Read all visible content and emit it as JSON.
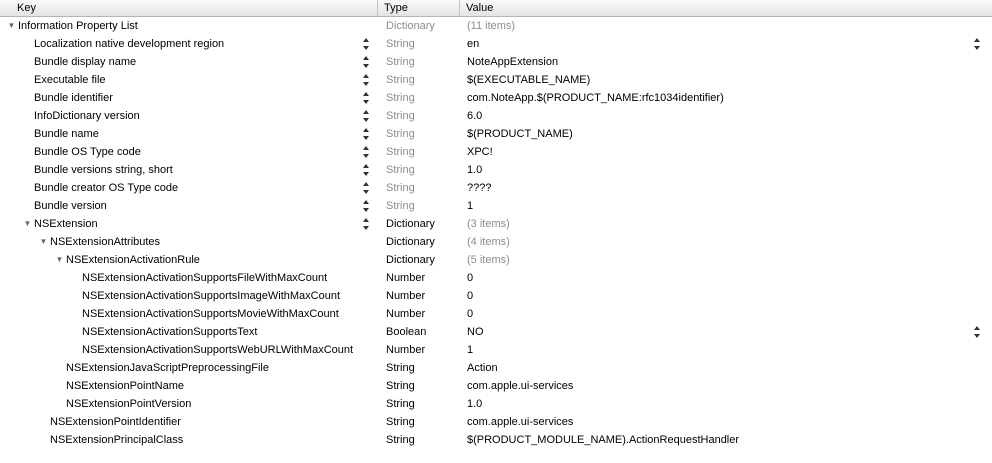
{
  "header": {
    "key": "Key",
    "type": "Type",
    "value": "Value"
  },
  "rows": [
    {
      "key": "Information Property List",
      "type": "Dictionary",
      "value": "(11 items)",
      "level": 0,
      "expand": true,
      "dim": true,
      "keyStepper": false,
      "valueStepper": false
    },
    {
      "key": "Localization native development region",
      "type": "String",
      "value": "en",
      "level": 1,
      "expand": false,
      "dim": false,
      "keyStepper": true,
      "valueStepper": true
    },
    {
      "key": "Bundle display name",
      "type": "String",
      "value": "NoteAppExtension",
      "level": 1,
      "expand": false,
      "dim": false,
      "keyStepper": true,
      "valueStepper": false
    },
    {
      "key": "Executable file",
      "type": "String",
      "value": "$(EXECUTABLE_NAME)",
      "level": 1,
      "expand": false,
      "dim": false,
      "keyStepper": true,
      "valueStepper": false
    },
    {
      "key": "Bundle identifier",
      "type": "String",
      "value": "com.NoteApp.$(PRODUCT_NAME:rfc1034identifier)",
      "level": 1,
      "expand": false,
      "dim": false,
      "keyStepper": true,
      "valueStepper": false
    },
    {
      "key": "InfoDictionary version",
      "type": "String",
      "value": "6.0",
      "level": 1,
      "expand": false,
      "dim": false,
      "keyStepper": true,
      "valueStepper": false
    },
    {
      "key": "Bundle name",
      "type": "String",
      "value": "$(PRODUCT_NAME)",
      "level": 1,
      "expand": false,
      "dim": false,
      "keyStepper": true,
      "valueStepper": false
    },
    {
      "key": "Bundle OS Type code",
      "type": "String",
      "value": "XPC!",
      "level": 1,
      "expand": false,
      "dim": false,
      "keyStepper": true,
      "valueStepper": false
    },
    {
      "key": "Bundle versions string, short",
      "type": "String",
      "value": "1.0",
      "level": 1,
      "expand": false,
      "dim": false,
      "keyStepper": true,
      "valueStepper": false
    },
    {
      "key": "Bundle creator OS Type code",
      "type": "String",
      "value": "????",
      "level": 1,
      "expand": false,
      "dim": false,
      "keyStepper": true,
      "valueStepper": false
    },
    {
      "key": "Bundle version",
      "type": "String",
      "value": "1",
      "level": 1,
      "expand": false,
      "dim": false,
      "keyStepper": true,
      "valueStepper": false
    },
    {
      "key": "NSExtension",
      "type": "Dictionary",
      "value": "(3 items)",
      "level": 1,
      "expand": true,
      "dim": true,
      "keyStepper": true,
      "valueStepper": false
    },
    {
      "key": "NSExtensionAttributes",
      "type": "Dictionary",
      "value": "(4 items)",
      "level": 2,
      "expand": true,
      "dim": true,
      "keyStepper": false,
      "valueStepper": false
    },
    {
      "key": "NSExtensionActivationRule",
      "type": "Dictionary",
      "value": "(5 items)",
      "level": 3,
      "expand": true,
      "dim": true,
      "keyStepper": false,
      "valueStepper": false
    },
    {
      "key": "NSExtensionActivationSupportsFileWithMaxCount",
      "type": "Number",
      "value": "0",
      "level": 4,
      "expand": false,
      "dim": false,
      "keyStepper": false,
      "valueStepper": false
    },
    {
      "key": "NSExtensionActivationSupportsImageWithMaxCount",
      "type": "Number",
      "value": "0",
      "level": 4,
      "expand": false,
      "dim": false,
      "keyStepper": false,
      "valueStepper": false
    },
    {
      "key": "NSExtensionActivationSupportsMovieWithMaxCount",
      "type": "Number",
      "value": "0",
      "level": 4,
      "expand": false,
      "dim": false,
      "keyStepper": false,
      "valueStepper": false
    },
    {
      "key": "NSExtensionActivationSupportsText",
      "type": "Boolean",
      "value": "NO",
      "level": 4,
      "expand": false,
      "dim": false,
      "keyStepper": false,
      "valueStepper": true
    },
    {
      "key": "NSExtensionActivationSupportsWebURLWithMaxCount",
      "type": "Number",
      "value": "1",
      "level": 4,
      "expand": false,
      "dim": false,
      "keyStepper": false,
      "valueStepper": false
    },
    {
      "key": "NSExtensionJavaScriptPreprocessingFile",
      "type": "String",
      "value": "Action",
      "level": 3,
      "expand": false,
      "dim": false,
      "keyStepper": false,
      "valueStepper": false
    },
    {
      "key": "NSExtensionPointName",
      "type": "String",
      "value": "com.apple.ui-services",
      "level": 3,
      "expand": false,
      "dim": false,
      "keyStepper": false,
      "valueStepper": false
    },
    {
      "key": "NSExtensionPointVersion",
      "type": "String",
      "value": "1.0",
      "level": 3,
      "expand": false,
      "dim": false,
      "keyStepper": false,
      "valueStepper": false
    },
    {
      "key": "NSExtensionPointIdentifier",
      "type": "String",
      "value": "com.apple.ui-services",
      "level": 2,
      "expand": false,
      "dim": false,
      "keyStepper": false,
      "valueStepper": false
    },
    {
      "key": "NSExtensionPrincipalClass",
      "type": "String",
      "value": "$(PRODUCT_MODULE_NAME).ActionRequestHandler",
      "level": 2,
      "expand": false,
      "dim": false,
      "keyStepper": false,
      "valueStepper": false
    }
  ]
}
